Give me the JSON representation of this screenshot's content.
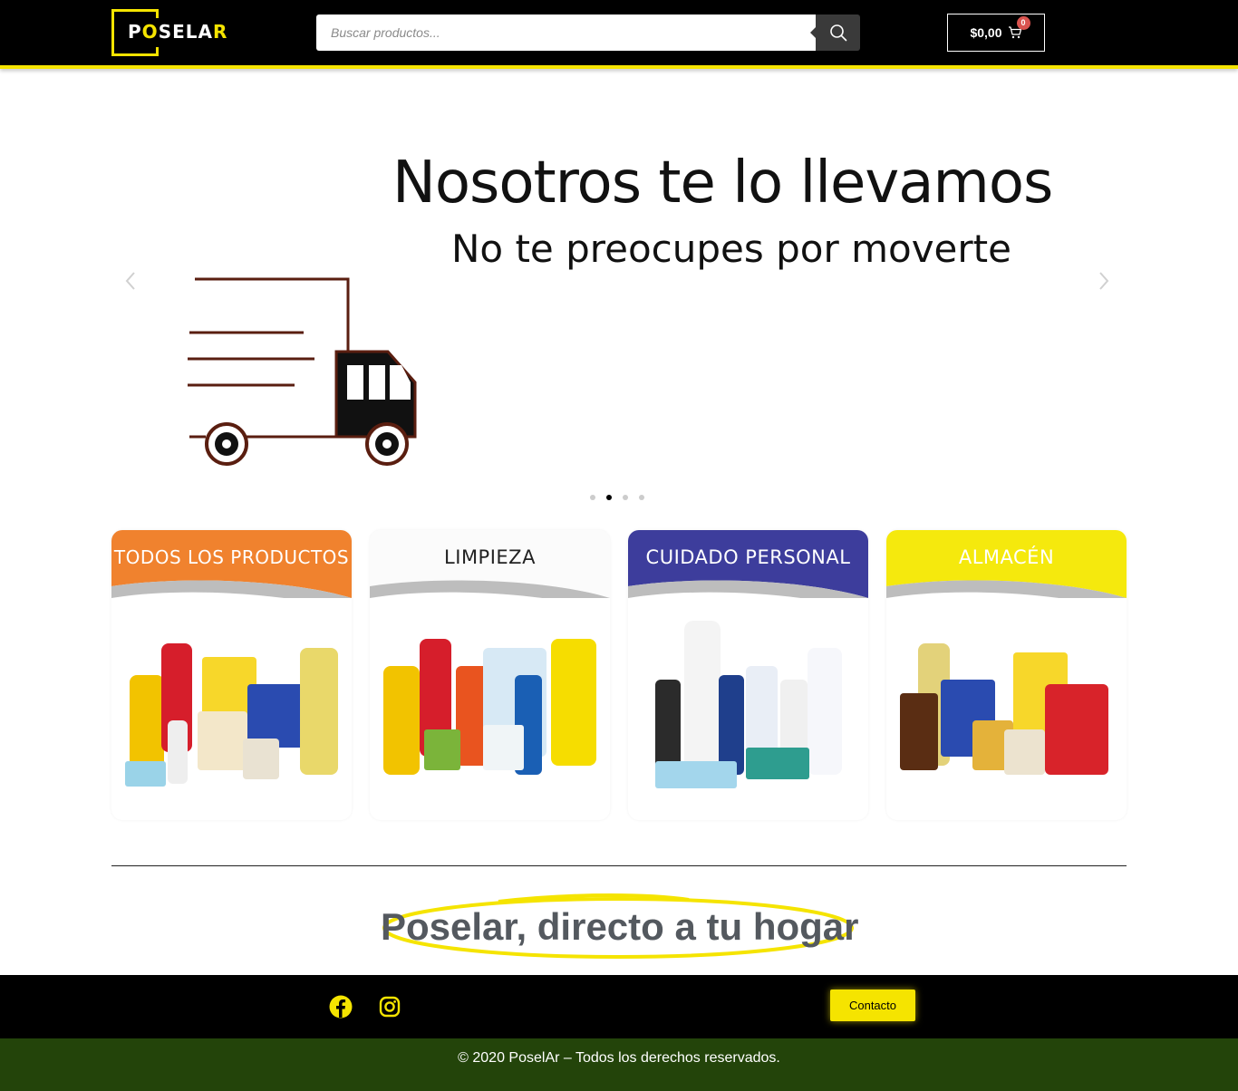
{
  "header": {
    "logo_text_a": "P",
    "logo_text_b": "O",
    "logo_text_c": "SELA",
    "logo_text_d": "R",
    "search_placeholder": "Buscar productos...",
    "search_icon": "search-icon",
    "cart_amount": "$0,00",
    "cart_count": "0",
    "cart_icon": "cart-icon"
  },
  "slider": {
    "title": "Nosotros te lo llevamos",
    "subtitle": "No te preocupes por moverte",
    "prev_icon": "chevron-left-icon",
    "next_icon": "chevron-right-icon",
    "slides_count": 4,
    "active_slide": 2
  },
  "categories": [
    {
      "title": "TODOS LOS PRODUCTOS",
      "color": "#f0822e",
      "text_color": "#ffffff"
    },
    {
      "title": "LIMPIEZA",
      "color": "#ffffff",
      "text_color": "#222222"
    },
    {
      "title": "CUIDADO PERSONAL",
      "color": "#3d3d9c",
      "text_color": "#ffffff"
    },
    {
      "title": "ALMACÉN",
      "color": "#f5e90d",
      "text_color": "#ffffff"
    }
  ],
  "tagline": "Poselar, directo a tu hogar",
  "footer": {
    "facebook_icon": "facebook-icon",
    "instagram_icon": "instagram-icon",
    "contact_label": "Contacto",
    "copyright": "© 2020 PoselAr – Todos los derechos reservados."
  },
  "colors": {
    "accent_yellow": "#f5e400",
    "footer_green": "#23440a",
    "header_black": "#000000"
  }
}
